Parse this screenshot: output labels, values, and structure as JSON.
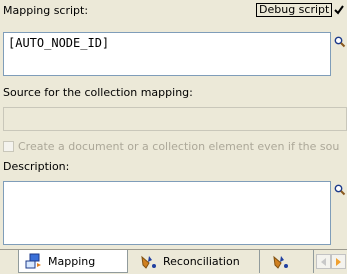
{
  "mapping_script": {
    "label": "Mapping script:",
    "debug_label": "Debug script",
    "debug_checked": true,
    "value": "[AUTO_NODE_ID]"
  },
  "source_collection": {
    "label": "Source for the collection mapping:",
    "value": ""
  },
  "create_document": {
    "label": "Create a document or a collection element even if the sou",
    "checked": false,
    "enabled": false
  },
  "description": {
    "label": "Description:",
    "value": ""
  },
  "tabs": [
    {
      "label": "Mapping",
      "icon": "mapping-icon",
      "active": true
    },
    {
      "label": "Reconciliation",
      "icon": "reconciliation-icon",
      "active": false
    },
    {
      "label": "",
      "icon": "tool-icon",
      "active": false
    }
  ],
  "colors": {
    "window_bg": "#ece9d8",
    "field_border": "#7f9db9",
    "disabled_text": "#aca899",
    "tab_arrow": "#f0a030"
  }
}
